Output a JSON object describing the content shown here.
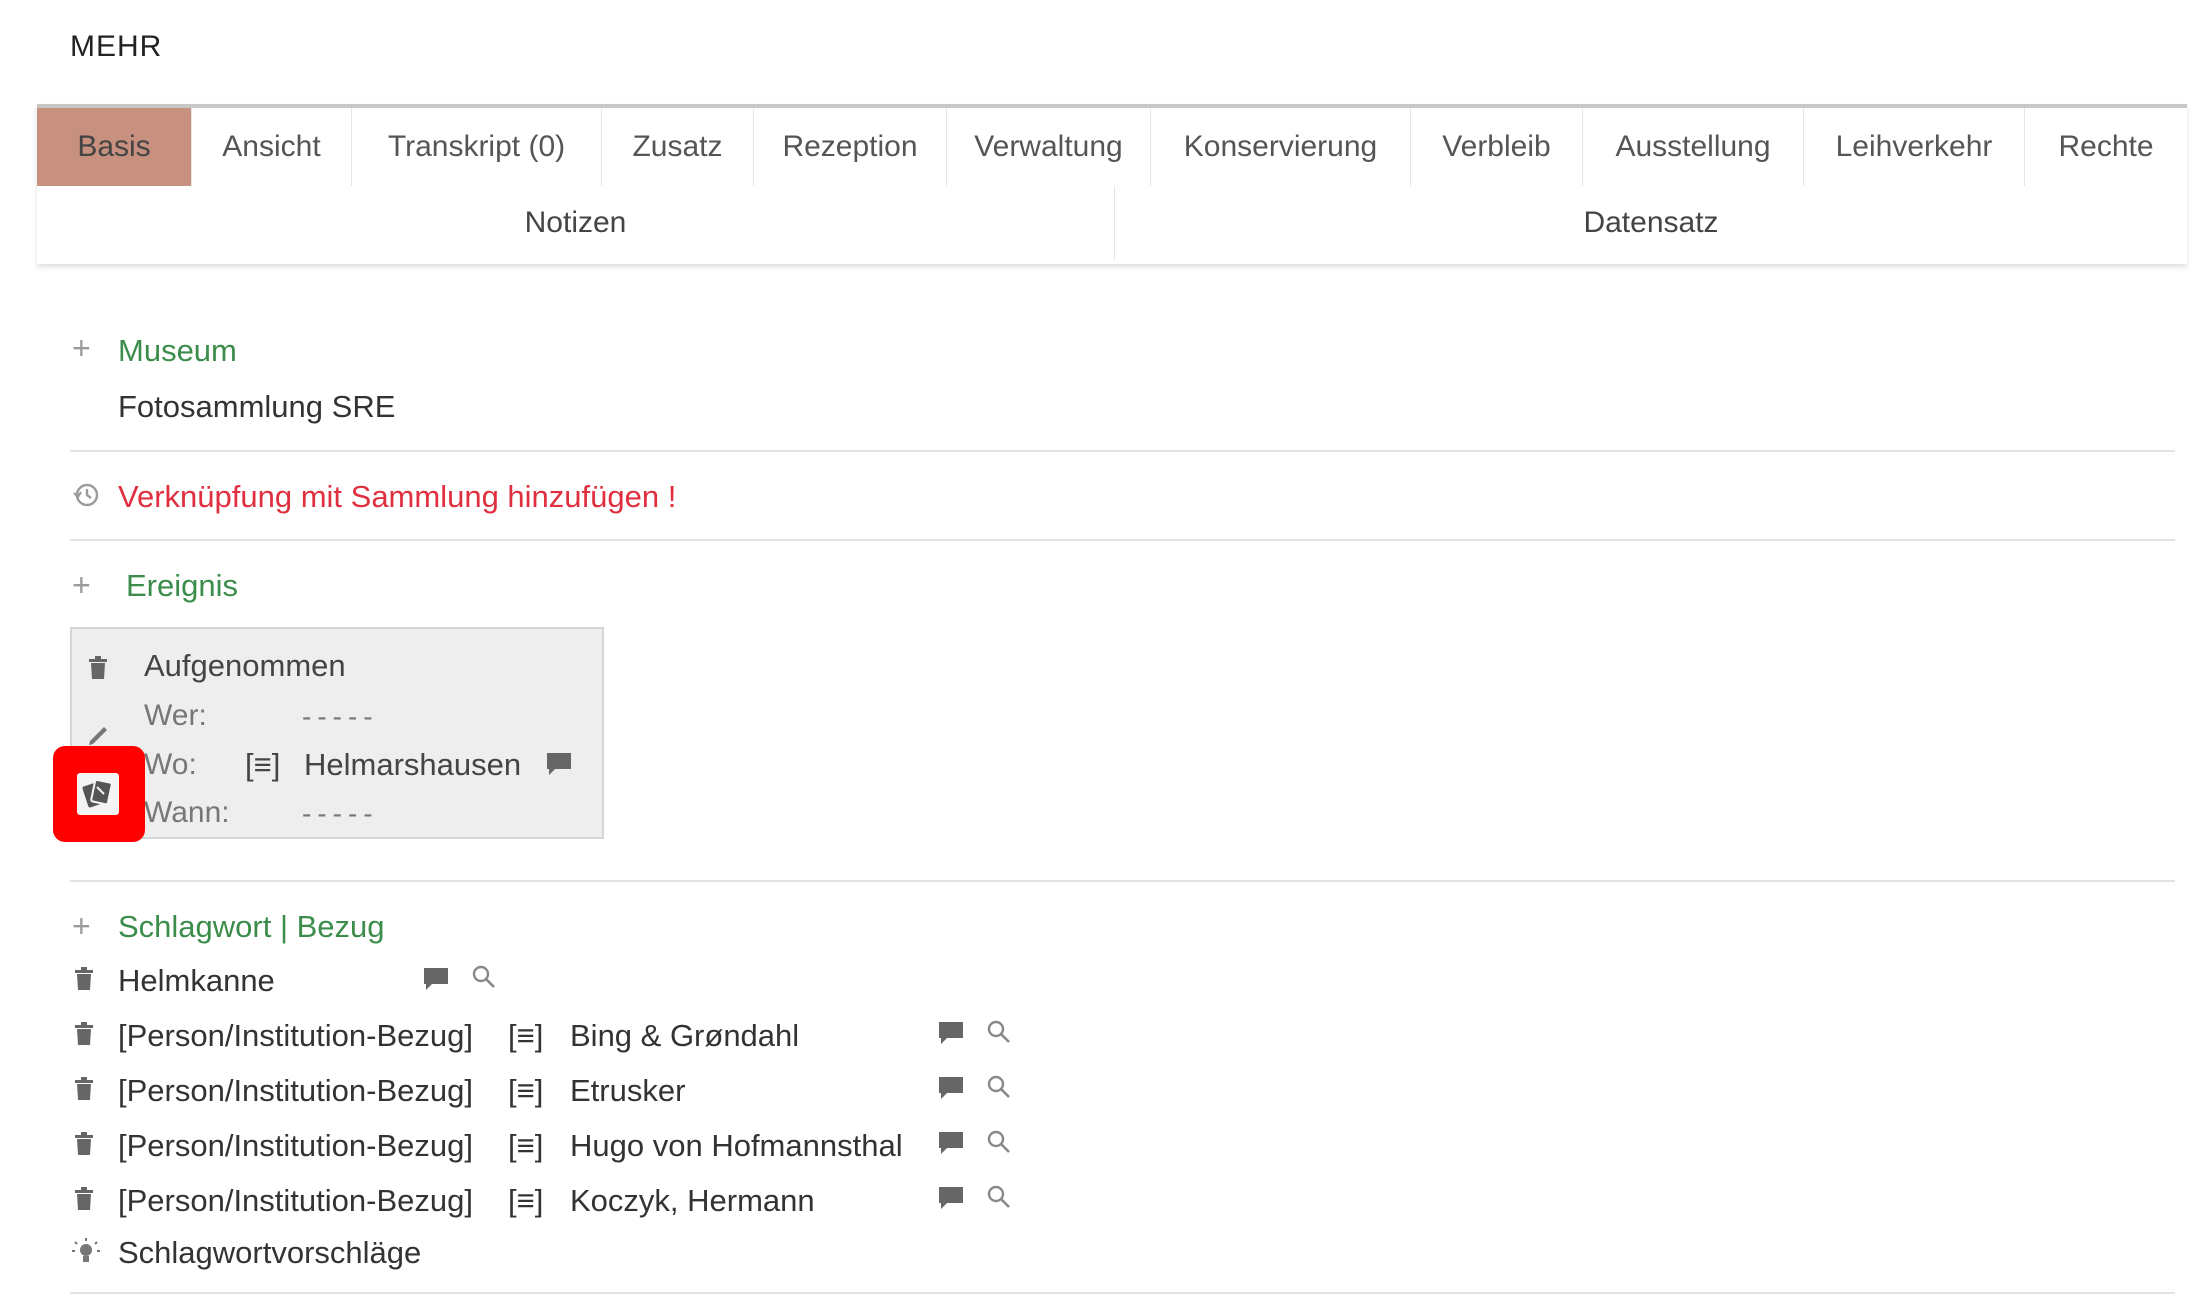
{
  "header": {
    "title": "MEHR"
  },
  "tabs_row1": [
    "Basis",
    "Ansicht",
    "Transkript (0)",
    "Zusatz",
    "Rezeption",
    "Verwaltung",
    "Konservierung",
    "Verbleib",
    "Ausstellung",
    "Leihverkehr",
    "Rechte"
  ],
  "tabs_row2": [
    "Notizen",
    "Datensatz"
  ],
  "museum": {
    "label": "Museum",
    "value": "Fotosammlung SRE"
  },
  "warning": {
    "text": "Verknüpfung mit Sammlung hinzufügen !"
  },
  "ereignis": {
    "label": "Ereignis",
    "event_title": "Aufgenommen",
    "wer_label": "Wer:",
    "wer_value": "-----",
    "wo_label": "Wo:",
    "wo_list_marker": "[≡]",
    "wo_value": "Helmarshausen",
    "wann_label": "Wann:",
    "wann_value": "-----"
  },
  "schlagwort": {
    "label": "Schlagwort | Bezug",
    "items": [
      {
        "prefix": "",
        "marker": "",
        "name": "Helmkanne"
      },
      {
        "prefix": "[Person/Institution-Bezug]",
        "marker": "[≡]",
        "name": "Bing & Grøndahl"
      },
      {
        "prefix": "[Person/Institution-Bezug]",
        "marker": "[≡]",
        "name": "Etrusker"
      },
      {
        "prefix": "[Person/Institution-Bezug]",
        "marker": "[≡]",
        "name": "Hugo von Hofmannsthal"
      },
      {
        "prefix": "[Person/Institution-Bezug]",
        "marker": "[≡]",
        "name": "Koczyk, Hermann"
      }
    ],
    "suggestions": "Schlagwortvorschläge"
  },
  "colors": {
    "accent_tab": "#c8907f",
    "green": "#3c8d4c",
    "warning": "#e03040",
    "highlight": "#ff0000"
  },
  "icons": [
    "plus-icon",
    "history-icon",
    "trash-icon",
    "pencil-icon",
    "cards-icon",
    "comment-icon",
    "search-icon",
    "lightbulb-icon"
  ]
}
